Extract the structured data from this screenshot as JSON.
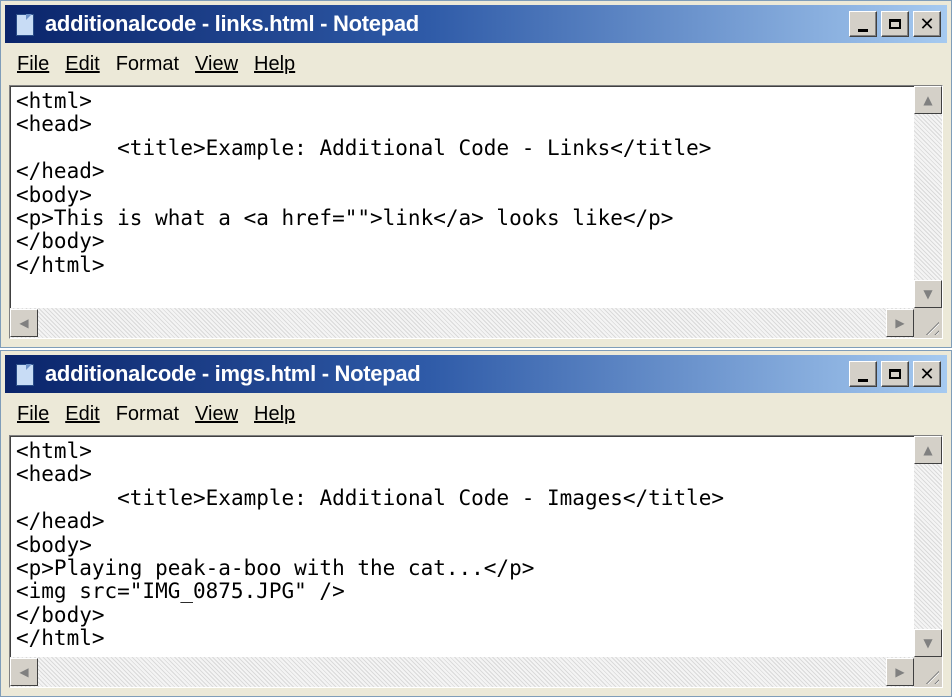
{
  "windows": [
    {
      "title": "additionalcode - links.html - Notepad",
      "menu": [
        "File",
        "Edit",
        "Format",
        "View",
        "Help"
      ],
      "content": "<html>\n<head>\n\t<title>Example: Additional Code - Links</title>\n</head>\n<body>\n<p>This is what a <a href=\"\">link</a> looks like</p>\n</body>\n</html>"
    },
    {
      "title": "additionalcode - imgs.html - Notepad",
      "menu": [
        "File",
        "Edit",
        "Format",
        "View",
        "Help"
      ],
      "content": "<html>\n<head>\n\t<title>Example: Additional Code - Images</title>\n</head>\n<body>\n<p>Playing peak-a-boo with the cat...</p>\n<img src=\"IMG_0875.JPG\" />\n</body>\n</html>"
    }
  ],
  "icons": {
    "app": "notepad-icon",
    "minimize": "minimize-icon",
    "maximize": "maximize-icon",
    "close": "close-icon",
    "scroll_up": "arrow-up-icon",
    "scroll_down": "arrow-down-icon",
    "scroll_left": "arrow-left-icon",
    "scroll_right": "arrow-right-icon"
  },
  "colors": {
    "titlebar_start": "#0a246a",
    "titlebar_end": "#a6caf0",
    "window_face": "#ece9d8"
  }
}
